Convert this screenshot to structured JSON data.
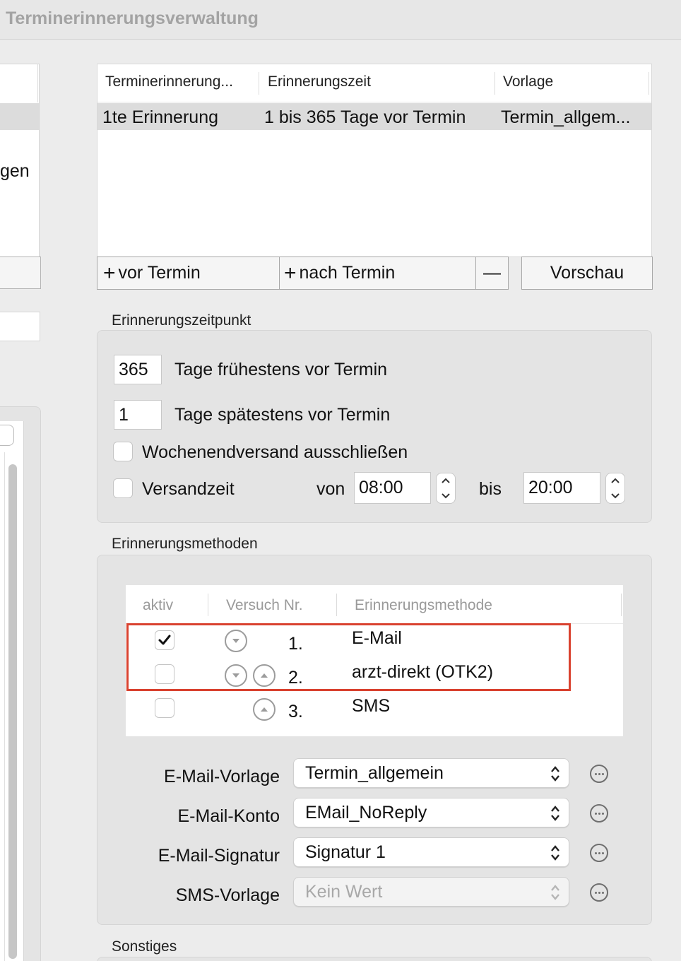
{
  "window": {
    "title": "Terminerinnerungsverwaltung"
  },
  "left_panel": {
    "partial_text": "gen"
  },
  "reminders_table": {
    "columns": [
      "Terminerinnerung...",
      "Erinnerungszeit",
      "Vorlage"
    ],
    "rows": [
      {
        "name": "1te Erinnerung",
        "time": "1 bis 365 Tage vor Termin",
        "template": "Termin_allgem..."
      }
    ]
  },
  "toolbar": {
    "add_before": "vor Termin",
    "add_after": "nach Termin",
    "remove": "—",
    "preview": "Vorschau",
    "plus": "+"
  },
  "reminder_time": {
    "section_label": "Erinnerungszeitpunkt",
    "earliest_value": "365",
    "earliest_label": "Tage frühestens vor Termin",
    "latest_value": "1",
    "latest_label": "Tage spätestens vor Termin",
    "exclude_weekend_label": "Wochenendversand ausschließen",
    "exclude_weekend_checked": false,
    "send_time_label": "Versandzeit",
    "send_time_checked": false,
    "from_label": "von",
    "from_value": "08:00",
    "to_label": "bis",
    "to_value": "20:00"
  },
  "methods": {
    "section_label": "Erinnerungsmethoden",
    "columns": [
      "aktiv",
      "Versuch Nr.",
      "Erinnerungsmethode"
    ],
    "rows": [
      {
        "active": true,
        "attempt": "1.",
        "method": "E-Mail",
        "can_move_down": true,
        "can_move_up": false
      },
      {
        "active": false,
        "attempt": "2.",
        "method": "arzt-direkt (OTK2)",
        "can_move_down": true,
        "can_move_up": true
      },
      {
        "active": false,
        "attempt": "3.",
        "method": "SMS",
        "can_move_down": false,
        "can_move_up": true
      }
    ],
    "highlight_color": "#d9422f"
  },
  "settings": {
    "email_template_label": "E-Mail-Vorlage",
    "email_template_value": "Termin_allgemein",
    "email_account_label": "E-Mail-Konto",
    "email_account_value": "EMail_NoReply",
    "email_signature_label": "E-Mail-Signatur",
    "email_signature_value": "Signatur 1",
    "sms_template_label": "SMS-Vorlage",
    "sms_template_value": "Kein Wert"
  },
  "misc": {
    "section_label": "Sonstiges"
  }
}
